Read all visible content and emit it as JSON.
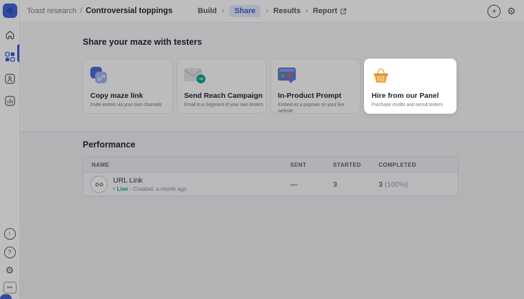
{
  "header": {
    "breadcrumb": {
      "project": "Toast research",
      "separator": "/",
      "current": "Controversial toppings"
    },
    "tabs": [
      {
        "label": "Build",
        "active": false
      },
      {
        "label": "Share",
        "active": true
      },
      {
        "label": "Results",
        "active": false
      },
      {
        "label": "Report",
        "active": false,
        "external": true
      }
    ]
  },
  "share_section": {
    "title": "Share your maze with testers",
    "cards": [
      {
        "title": "Copy maze link",
        "description": "Invite testers via your own channels",
        "icon": "link-squares"
      },
      {
        "title": "Send Reach Campaign",
        "description": "Email to a Segment of your own testers",
        "icon": "envelope-send"
      },
      {
        "title": "In-Product Prompt",
        "description": "Embed as a popover on your live website",
        "icon": "browser-popover"
      },
      {
        "title": "Hire from our Panel",
        "description": "Purchase credits and recruit testers",
        "icon": "shopping-basket",
        "highlighted": true
      }
    ]
  },
  "performance": {
    "title": "Performance",
    "columns": {
      "name": "NAME",
      "sent": "SENT",
      "started": "STARTED",
      "completed": "COMPLETED"
    },
    "row": {
      "name": "URL Link",
      "status": "Live",
      "meta": "· Created: a month ago",
      "sent": "—",
      "started": "3",
      "completed_count": "3",
      "completed_pct": "(100%)"
    }
  },
  "glyphs": {
    "chevron": "›",
    "plus": "+",
    "gear": "⚙",
    "up_arrow": "↑",
    "help": "?",
    "collapse": "↦",
    "bullet": "▪",
    "send_arrow": "➔"
  },
  "colors": {
    "accent_blue": "#2e5bd6",
    "live_teal": "#0e9e8a",
    "basket_orange": "#f0a23c",
    "highlight_card_bg": "#ffffff",
    "dim_overlay": "rgba(14,14,20,0.27)"
  }
}
